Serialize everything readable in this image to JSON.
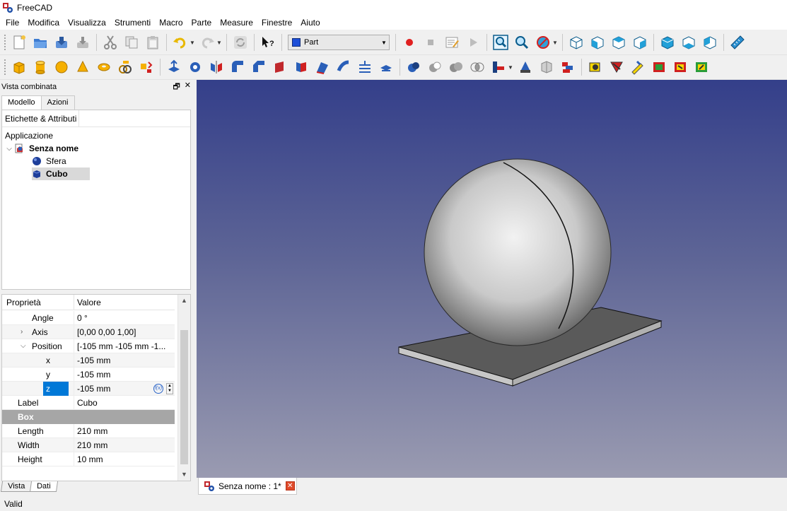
{
  "window": {
    "title": "FreeCAD"
  },
  "menu": [
    "File",
    "Modifica",
    "Visualizza",
    "Strumenti",
    "Macro",
    "Parte",
    "Measure",
    "Finestre",
    "Aiuto"
  ],
  "workbench": {
    "selected": "Part"
  },
  "toolbar1_icons": [
    [
      "new-document-icon",
      "open-document-icon",
      "save-document-icon",
      "save-as-icon"
    ],
    [
      "cut-icon",
      "copy-icon",
      "paste-icon"
    ],
    [
      "undo-icon",
      "redo-icon"
    ],
    [
      "refresh-icon"
    ],
    [
      "whats-this-icon"
    ]
  ],
  "toolbar1_right_icons": [
    "record-macro-icon",
    "stop-macro-icon",
    "edit-macro-icon",
    "execute-macro-icon",
    "fit-all-icon",
    "fit-selection-icon",
    "draw-style-icon",
    "isometric-view-icon",
    "front-view-icon",
    "top-view-icon",
    "right-view-icon",
    "rear-view-icon",
    "bottom-view-icon",
    "left-view-icon",
    "measure-icon"
  ],
  "toolbar2_icons": [
    "box-icon",
    "cylinder-icon",
    "sphere-icon",
    "cone-icon",
    "torus-icon",
    "tube-icon",
    "primitives-icon",
    "shape-builder-icon",
    "extrude-icon",
    "revolve-icon",
    "mirror-icon",
    "fillet-icon",
    "chamfer-icon",
    "make-face-icon",
    "ruled-surface-icon",
    "loft-icon",
    "sweep-icon",
    "section-icon",
    "cross-sections-icon",
    "offset-icon",
    "thickness-icon",
    "projection-icon",
    "boolean-icon",
    "cut-boolean-icon",
    "fuse-icon",
    "common-icon",
    "section-boolean-icon",
    "join-features-icon",
    "split-features-icon",
    "compound-icon",
    "explode-compound-icon",
    "compound-filter-icon",
    "check-geometry-icon",
    "defeaturing-icon",
    "attachment-icon",
    "color-per-face-icon",
    "measure-linear-icon",
    "measure-angular-icon"
  ],
  "combo_view": {
    "title": "Vista combinata",
    "tabs": [
      "Modello",
      "Azioni"
    ],
    "tree_header": "Etichette & Attributi",
    "tree": {
      "root_label": "Applicazione",
      "document": "Senza nome",
      "items": [
        "Sfera",
        "Cubo"
      ],
      "selected": "Cubo"
    },
    "properties": {
      "col_property": "Proprietà",
      "col_value": "Valore",
      "rows": [
        {
          "name": "Angle",
          "value": "0 °"
        },
        {
          "name": "Axis",
          "value": "[0,00 0,00 1,00]"
        },
        {
          "name": "Position",
          "value": "[-105 mm  -105 mm  -1..."
        },
        {
          "name": "x",
          "value": "-105 mm"
        },
        {
          "name": "y",
          "value": "-105 mm"
        },
        {
          "name": "z",
          "value": "-105 mm"
        },
        {
          "name": "Label",
          "value": "Cubo"
        }
      ],
      "group_box": "Box",
      "box_rows": [
        {
          "name": "Length",
          "value": "210 mm"
        },
        {
          "name": "Width",
          "value": "210 mm"
        },
        {
          "name": "Height",
          "value": "10 mm"
        }
      ]
    },
    "bottom_tabs": [
      "Vista",
      "Dati"
    ]
  },
  "document_tab": {
    "label": "Senza nome : 1*"
  },
  "status": {
    "text": "Valid"
  },
  "colors": {
    "view_top": "#343f8a",
    "view_bottom": "#9a9bb1",
    "selection_blue": "#0078d7",
    "group_row_gray": "#a6a6a6"
  }
}
